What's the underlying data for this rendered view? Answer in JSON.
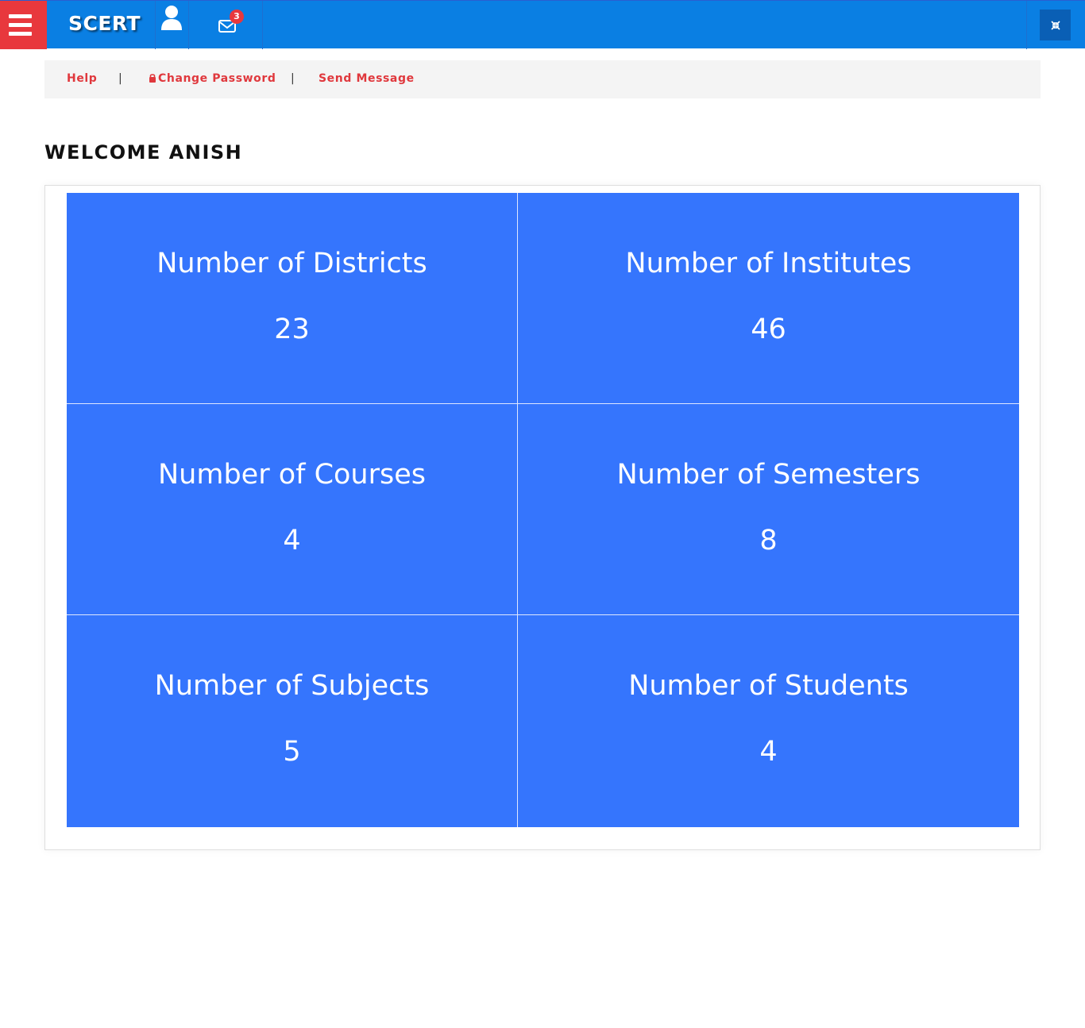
{
  "app": {
    "brand": "SCERT"
  },
  "header": {
    "menu_icon": "hamburger-icon",
    "user_icon": "user-icon",
    "mail_icon": "envelope-icon",
    "mail_badge": "3",
    "fullscreen_icon": "fullscreen-icon"
  },
  "subnav": {
    "help": "Help",
    "separator": "|",
    "change_password": "Change Password",
    "change_password_icon": "lock-icon",
    "send_message": "Send Message"
  },
  "page": {
    "welcome": "WELCOME ANISH"
  },
  "stats": [
    {
      "label": "Number of Districts",
      "value": "23"
    },
    {
      "label": "Number of Institutes",
      "value": "46"
    },
    {
      "label": "Number of Courses",
      "value": "4"
    },
    {
      "label": "Number of Semesters",
      "value": "8"
    },
    {
      "label": "Number of Subjects",
      "value": "5"
    },
    {
      "label": "Number of Students",
      "value": "4"
    }
  ],
  "colors": {
    "topbar": "#0a7fe3",
    "menu_button": "#e8383d",
    "tile": "#3575fd",
    "link": "#e0383d"
  }
}
